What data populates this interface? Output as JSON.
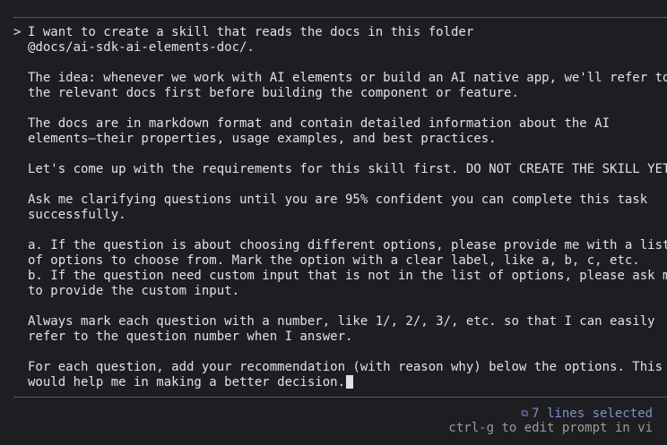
{
  "prompt": {
    "caret": ">",
    "lines": [
      "I want to create a skill that reads the docs in this folder",
      "@docs/ai-sdk-ai-elements-doc/.",
      "",
      "The idea: whenever we work with AI elements or build an AI native app, we'll refer to",
      "the relevant docs first before building the component or feature.",
      "",
      "The docs are in markdown format and contain detailed information about the AI",
      "elements—their properties, usage examples, and best practices.",
      "",
      "Let's come up with the requirements for this skill first. DO NOT CREATE THE SKILL YET.",
      "",
      "Ask me clarifying questions until you are 95% confident you can complete this task",
      "successfully.",
      "",
      "a. If the question is about choosing different options, please provide me with a list",
      "of options to choose from. Mark the option with a clear label, like a, b, c, etc.",
      "b. If the question need custom input that is not in the list of options, please ask me",
      "to provide the custom input.",
      "",
      "Always mark each question with a number, like 1/, 2/, 3/, etc. so that I can easily",
      "refer to the question number when I answer.",
      "",
      "For each question, add your recommendation (with reason why) below the options. This",
      "would help me in making a better decision."
    ]
  },
  "status": {
    "selection_icon": "⧉",
    "selection_text": "7 lines selected",
    "hint": "ctrl-g to edit prompt in vi"
  },
  "colors": {
    "background": "#1e1e22",
    "text": "#e2e2e2",
    "accent": "#7d8fcf",
    "muted": "#9a9a9f"
  }
}
